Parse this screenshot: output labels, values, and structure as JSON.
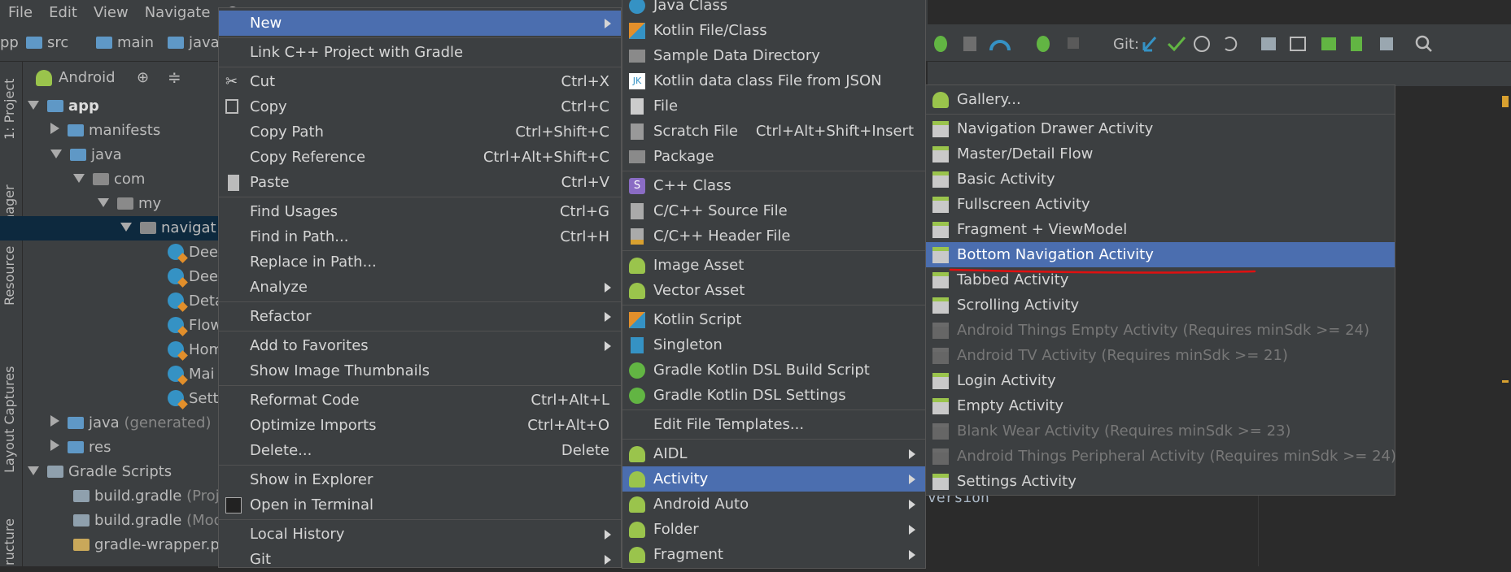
{
  "menubar": [
    "File",
    "Edit",
    "View",
    "Navigate",
    "C"
  ],
  "breadcrumb": [
    "pp",
    "src",
    "main",
    "java"
  ],
  "toolbar": {
    "git_label": "Git:"
  },
  "left_strip": {
    "project": "1: Project",
    "resource": "Resource Manager",
    "layout": "Layout Captures",
    "structure": "ructure"
  },
  "project_panel": {
    "view": "Android"
  },
  "tree": [
    {
      "label": "app"
    },
    {
      "label": "manifests"
    },
    {
      "label": "java"
    },
    {
      "label": "com"
    },
    {
      "label": "my"
    },
    {
      "label": "navigat"
    },
    {
      "label": "Dee"
    },
    {
      "label": "Dee"
    },
    {
      "label": "Deta"
    },
    {
      "label": "Flow"
    },
    {
      "label": "Hom"
    },
    {
      "label": "Mai"
    },
    {
      "label": "Sett"
    },
    {
      "label": "java",
      "suffix": "(generated)"
    },
    {
      "label": "res"
    },
    {
      "label": "Gradle Scripts"
    },
    {
      "label": "build.gradle",
      "suffix": "(Proj"
    },
    {
      "label": "build.gradle",
      "suffix": "(Mod"
    },
    {
      "label": "gradle-wrapper.p"
    }
  ],
  "editor": {
    "visible_text": "version"
  },
  "context_menu": [
    {
      "label": "New",
      "submenu": true,
      "selected": true
    },
    {
      "label": "Link C++ Project with Gradle"
    },
    {
      "label": "Cut",
      "shortcut": "Ctrl+X"
    },
    {
      "label": "Copy",
      "shortcut": "Ctrl+C"
    },
    {
      "label": "Copy Path",
      "shortcut": "Ctrl+Shift+C"
    },
    {
      "label": "Copy Reference",
      "shortcut": "Ctrl+Alt+Shift+C"
    },
    {
      "label": "Paste",
      "shortcut": "Ctrl+V"
    },
    {
      "label": "Find Usages",
      "shortcut": "Ctrl+G"
    },
    {
      "label": "Find in Path...",
      "shortcut": "Ctrl+H"
    },
    {
      "label": "Replace in Path..."
    },
    {
      "label": "Analyze",
      "submenu": true
    },
    {
      "label": "Refactor",
      "submenu": true
    },
    {
      "label": "Add to Favorites",
      "submenu": true
    },
    {
      "label": "Show Image Thumbnails"
    },
    {
      "label": "Reformat Code",
      "shortcut": "Ctrl+Alt+L"
    },
    {
      "label": "Optimize Imports",
      "shortcut": "Ctrl+Alt+O"
    },
    {
      "label": "Delete...",
      "shortcut": "Delete"
    },
    {
      "label": "Show in Explorer"
    },
    {
      "label": "Open in Terminal"
    },
    {
      "label": "Local History",
      "submenu": true
    },
    {
      "label": "Git",
      "submenu": true
    }
  ],
  "new_menu": [
    {
      "label": "Java Class"
    },
    {
      "label": "Kotlin File/Class"
    },
    {
      "label": "Sample Data Directory"
    },
    {
      "label": "Kotlin data class File from JSON"
    },
    {
      "label": "File"
    },
    {
      "label": "Scratch File",
      "shortcut": "Ctrl+Alt+Shift+Insert"
    },
    {
      "label": "Package"
    },
    {
      "label": "C++ Class"
    },
    {
      "label": "C/C++ Source File"
    },
    {
      "label": "C/C++ Header File"
    },
    {
      "label": "Image Asset"
    },
    {
      "label": "Vector Asset"
    },
    {
      "label": "Kotlin Script"
    },
    {
      "label": "Singleton"
    },
    {
      "label": "Gradle Kotlin DSL Build Script"
    },
    {
      "label": "Gradle Kotlin DSL Settings"
    },
    {
      "label": "Edit File Templates..."
    },
    {
      "label": "AIDL",
      "submenu": true
    },
    {
      "label": "Activity",
      "submenu": true,
      "selected": true
    },
    {
      "label": "Android Auto",
      "submenu": true
    },
    {
      "label": "Folder",
      "submenu": true
    },
    {
      "label": "Fragment",
      "submenu": true
    }
  ],
  "activity_menu": [
    {
      "label": "Gallery..."
    },
    {
      "label": "Navigation Drawer Activity"
    },
    {
      "label": "Master/Detail Flow"
    },
    {
      "label": "Basic Activity"
    },
    {
      "label": "Fullscreen Activity"
    },
    {
      "label": "Fragment + ViewModel"
    },
    {
      "label": "Bottom Navigation Activity",
      "selected": true
    },
    {
      "label": "Tabbed Activity"
    },
    {
      "label": "Scrolling Activity"
    },
    {
      "label": "Android Things Empty Activity (Requires minSdk >= 24)",
      "disabled": true
    },
    {
      "label": "Android TV Activity (Requires minSdk >= 21)",
      "disabled": true
    },
    {
      "label": "Login Activity"
    },
    {
      "label": "Empty Activity"
    },
    {
      "label": "Blank Wear Activity (Requires minSdk >= 23)",
      "disabled": true
    },
    {
      "label": "Android Things Peripheral Activity (Requires minSdk >= 24)",
      "disabled": true
    },
    {
      "label": "Settings Activity"
    }
  ],
  "colors": {
    "selection": "#4b6eaf",
    "annotation_underline": "#e01010",
    "android_green": "#9ac44c"
  }
}
